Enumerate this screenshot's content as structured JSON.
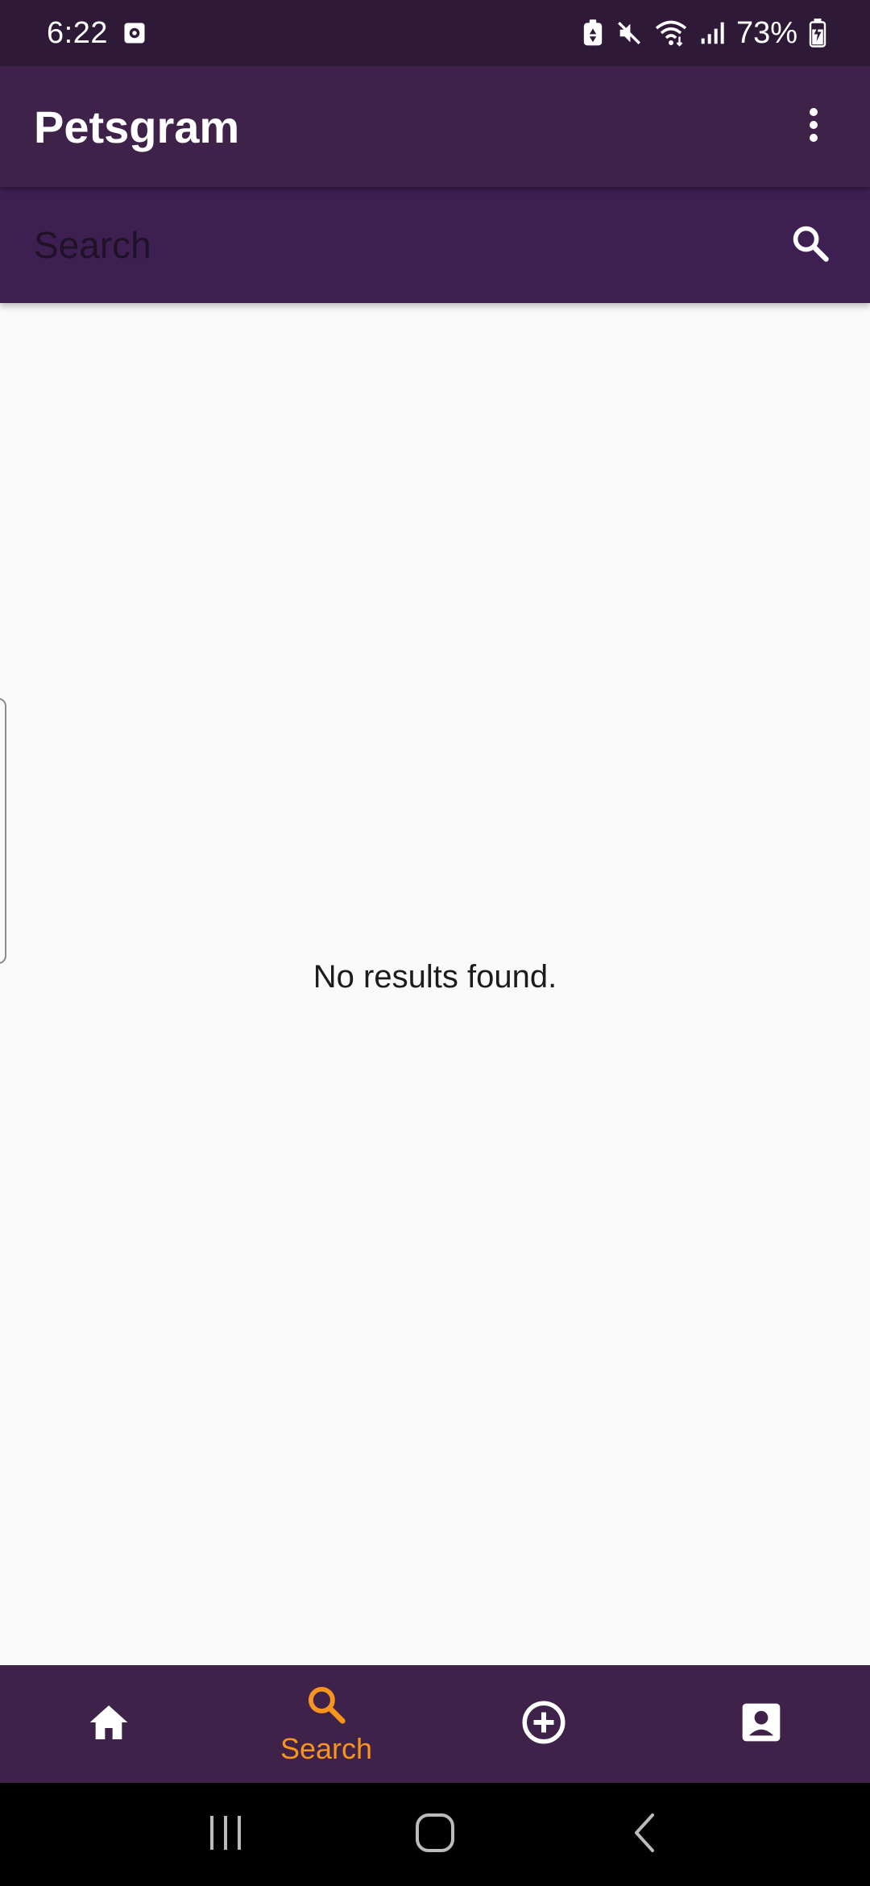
{
  "status_bar": {
    "time": "6:22",
    "battery_percent": "73%",
    "icons": [
      "screen-record-icon",
      "battery-saver-icon",
      "mute-icon",
      "wifi-icon",
      "signal-icon",
      "battery-charging-icon"
    ]
  },
  "app_bar": {
    "title": "Petsgram",
    "menu_icon": "more-vert-icon"
  },
  "search": {
    "placeholder": "Search",
    "value": "",
    "icon": "search-icon"
  },
  "main": {
    "empty_message": "No results found."
  },
  "bottom_nav": {
    "items": [
      {
        "icon": "home-icon",
        "label": "",
        "active": false
      },
      {
        "icon": "search-icon",
        "label": "Search",
        "active": true
      },
      {
        "icon": "add-circle-icon",
        "label": "",
        "active": false
      },
      {
        "icon": "account-box-icon",
        "label": "",
        "active": false
      }
    ]
  },
  "system_nav": {
    "buttons": [
      "recent-apps-icon",
      "home-button-icon",
      "back-icon"
    ]
  },
  "colors": {
    "status_bar": "#2e1a36",
    "app_bar": "#3e2249",
    "search_bar": "#3d2051",
    "accent": "#f7941d",
    "background": "#fafafa"
  }
}
